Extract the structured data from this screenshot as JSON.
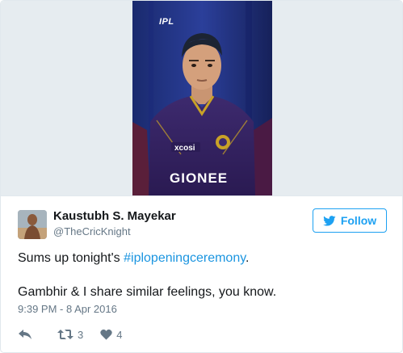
{
  "media": {
    "overlay_logo": "IPL",
    "jersey_text": "GIONEE",
    "jersey_sponsor": "xcosi"
  },
  "user": {
    "name": "Kaustubh S. Mayekar",
    "handle": "@TheCricKnight"
  },
  "follow_button": {
    "label": "Follow",
    "icon": "twitter-bird-icon"
  },
  "tweet": {
    "text_line1_before": "Sums up tonight's ",
    "hashtag": "#iplopeningceremony",
    "text_line1_after": ".",
    "text_line2": "Gambhir & I share similar feelings, you know.",
    "timestamp": "9:39 PM - 8 Apr 2016"
  },
  "actions": {
    "reply_icon": "reply-icon",
    "retweet_icon": "retweet-icon",
    "retweet_count": "3",
    "like_icon": "heart-icon",
    "like_count": "4"
  },
  "colors": {
    "accent": "#1da1f2",
    "link": "#1b95e0",
    "muted": "#657786",
    "border": "#e1e8ed",
    "kkr_purple": "#3a2464"
  }
}
